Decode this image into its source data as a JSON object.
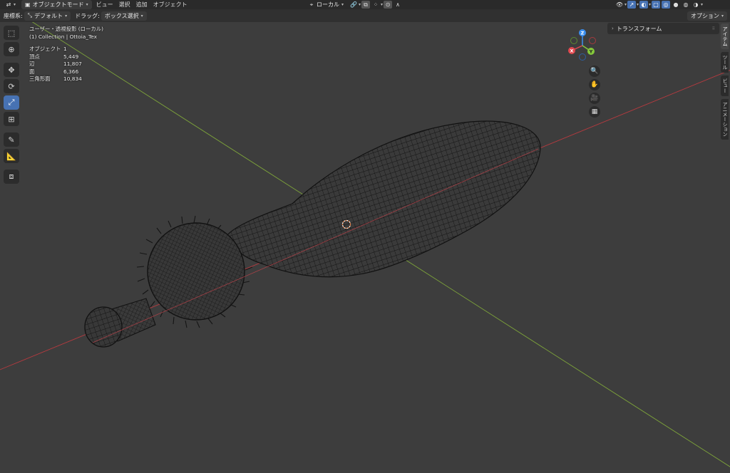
{
  "header": {
    "mode": "オブジェクトモード",
    "menus": [
      "ビュー",
      "選択",
      "追加",
      "オブジェクト"
    ],
    "pivot": "ローカル"
  },
  "toolheader": {
    "orientation_label": "座標系:",
    "orientation_value": "デフォルト",
    "drag_label": "ドラッグ:",
    "drag_value": "ボックス選択",
    "options": "オプション"
  },
  "overlay": {
    "view_name": "ユーザー・透視投影 (ローカル)",
    "collection": "(1) Collection | Ottoia_Tex",
    "stats": [
      {
        "label": "オブジェクト",
        "value": "1"
      },
      {
        "label": "頂点",
        "value": "5,449"
      },
      {
        "label": "辺",
        "value": "11,807"
      },
      {
        "label": "面",
        "value": "6,366"
      },
      {
        "label": "三角形面",
        "value": "10,834"
      }
    ]
  },
  "gizmo": {
    "z": "Z",
    "x": "X",
    "y": "Y"
  },
  "npanel": {
    "section": "トランスフォーム",
    "tabs": [
      "アイテム",
      "ツール",
      "ビュー",
      "アニメーション"
    ]
  },
  "colors": {
    "accent": "#4772b3",
    "x_axis": "#e2484f",
    "y_axis": "#85c93b",
    "z_axis": "#3b8ff0"
  }
}
